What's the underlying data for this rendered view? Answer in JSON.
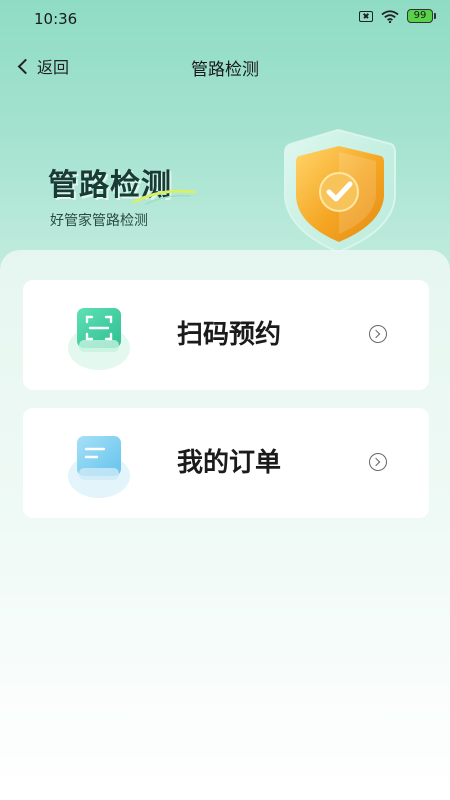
{
  "status_bar": {
    "time": "10:36",
    "battery": "99"
  },
  "nav": {
    "back_label": "返回",
    "title": "管路检测"
  },
  "hero": {
    "title": "管路检测",
    "subtitle": "好管家管路检测"
  },
  "menu": [
    {
      "label": "扫码预约",
      "icon": "scan-icon"
    },
    {
      "label": "我的订单",
      "icon": "order-list-icon"
    }
  ],
  "colors": {
    "accent_green": "#3ccaa0",
    "shield_gold": "#f3b23a",
    "order_blue": "#8ad3f1"
  }
}
